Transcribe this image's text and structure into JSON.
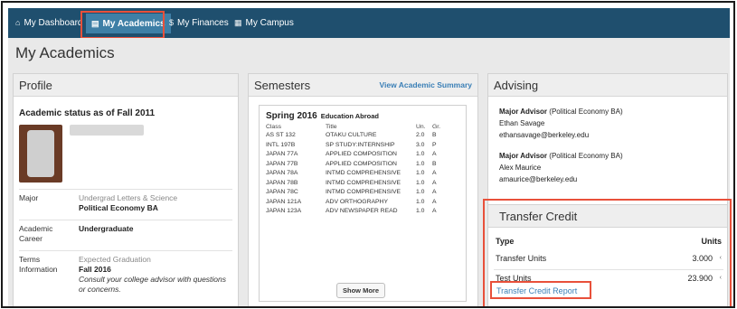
{
  "nav": {
    "items": [
      {
        "icon": "home-icon",
        "glyph": "⌂",
        "label": "My Dashboard"
      },
      {
        "icon": "book-icon",
        "glyph": "▤",
        "label": "My Academics"
      },
      {
        "icon": "dollar-icon",
        "glyph": "$",
        "label": "My Finances"
      },
      {
        "icon": "grid-icon",
        "glyph": "▦",
        "label": "My Campus"
      }
    ],
    "active_index": 1
  },
  "page": {
    "title": "My Academics"
  },
  "profile": {
    "heading": "Profile",
    "status_title": "Academic status as of Fall 2011",
    "rows": [
      {
        "label": "Major",
        "lines": [
          "Undergrad Letters & Science",
          "Political Economy BA"
        ]
      },
      {
        "label": "Academic Career",
        "lines": [
          "Undergraduate"
        ]
      },
      {
        "label": "Terms Information",
        "lines": [
          "Expected Graduation",
          "Fall 2016",
          "Consult your college advisor with questions or concerns."
        ]
      }
    ]
  },
  "semesters": {
    "heading": "Semesters",
    "summary_link": "View Academic Summary",
    "term": "Spring 2016",
    "term_note": "Education Abroad",
    "columns": [
      "Class",
      "Title",
      "Un.",
      "Gr."
    ],
    "courses": [
      {
        "cls": "AS ST 132",
        "title": "OTAKU CULTURE",
        "units": "2.0",
        "grade": "B"
      },
      {
        "cls": "INTL 197B",
        "title": "SP STUDY:INTERNSHIP",
        "units": "3.0",
        "grade": "P"
      },
      {
        "cls": "JAPAN 77A",
        "title": "APPLIED COMPOSITION",
        "units": "1.0",
        "grade": "A"
      },
      {
        "cls": "JAPAN 77B",
        "title": "APPLIED COMPOSITION",
        "units": "1.0",
        "grade": "B"
      },
      {
        "cls": "JAPAN 78A",
        "title": "INTMD COMPREHENSIVE",
        "units": "1.0",
        "grade": "A"
      },
      {
        "cls": "JAPAN 78B",
        "title": "INTMD COMPREHENSIVE",
        "units": "1.0",
        "grade": "A"
      },
      {
        "cls": "JAPAN 78C",
        "title": "INTMD COMPREHENSIVE",
        "units": "1.0",
        "grade": "A"
      },
      {
        "cls": "JAPAN 121A",
        "title": "ADV ORTHOGRAPHY",
        "units": "1.0",
        "grade": "A"
      },
      {
        "cls": "JAPAN 123A",
        "title": "ADV NEWSPAPER READ",
        "units": "1.0",
        "grade": "A"
      }
    ],
    "show_more": "Show More"
  },
  "advising": {
    "heading": "Advising",
    "advisors": [
      {
        "role": "Major Advisor",
        "program": "(Political Economy BA)",
        "name": "Ethan Savage",
        "email": "ethansavage@berkeley.edu"
      },
      {
        "role": "Major Advisor",
        "program": "(Political Economy BA)",
        "name": "Alex Maurice",
        "email": "amaurice@berkeley.edu"
      }
    ]
  },
  "transfer_credit": {
    "heading": "Transfer Credit",
    "col_type": "Type",
    "col_units": "Units",
    "rows": [
      {
        "type": "Transfer Units",
        "units": "3.000"
      },
      {
        "type": "Test Units",
        "units": "23.900"
      }
    ],
    "report_link": "Transfer Credit Report"
  },
  "colors": {
    "nav_bg": "#1f4f6e",
    "active_tab": "#3e7fa6",
    "link": "#3a7fb6",
    "highlight": "#e8503a"
  }
}
